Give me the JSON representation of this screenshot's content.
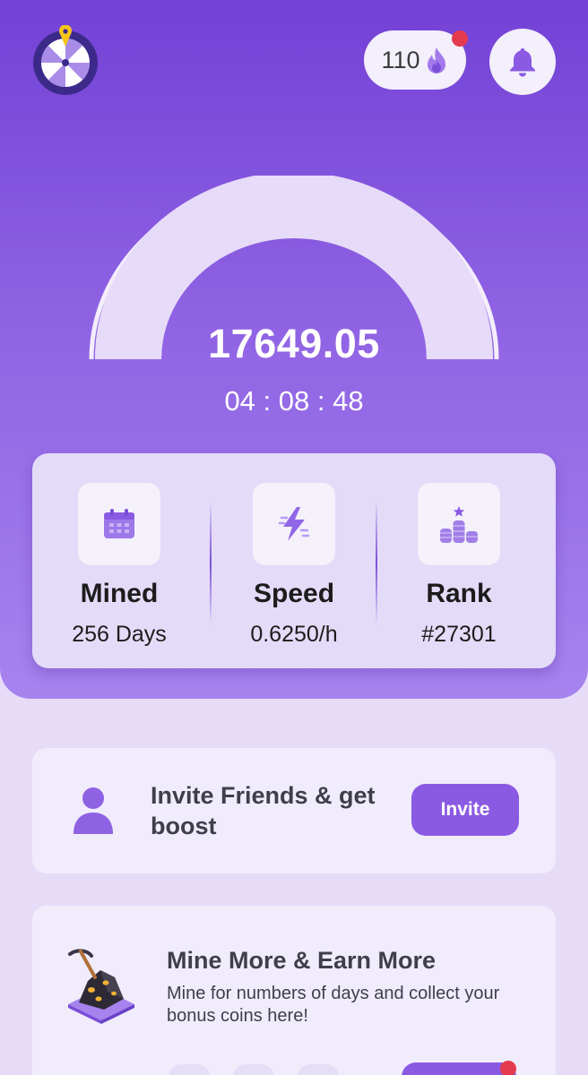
{
  "header": {
    "streak": {
      "count": "110",
      "icon": "flame-icon",
      "has_notification_dot": true
    },
    "wheel_icon": "spin-wheel-icon",
    "bell_icon": "bell-icon"
  },
  "miner": {
    "balance": "17649.05",
    "countdown": "04 : 08 : 48",
    "progress": 1.0
  },
  "stats": [
    {
      "icon": "calendar-icon",
      "title": "Mined",
      "value": "256 Days"
    },
    {
      "icon": "lightning-icon",
      "title": "Speed",
      "value": "0.6250/h"
    },
    {
      "icon": "ranking-icon",
      "title": "Rank",
      "value": "#27301"
    }
  ],
  "invite": {
    "icon": "user-icon",
    "text": "Invite Friends & get boost",
    "button_label": "Invite"
  },
  "mine_more": {
    "icon": "mining-rock-icon",
    "heading": "Mine More & Earn More",
    "description": "Mine for numbers of days and collect your bonus coins here!"
  },
  "colors": {
    "primary": "#7a4fd8",
    "hero_top": "#7341d6",
    "hero_bottom": "#a783ee",
    "page_bg": "#e6dcf8",
    "card_bg": "#f1ecfb",
    "alert": "#e53b4f",
    "accent_yellow": "#f5c518"
  }
}
